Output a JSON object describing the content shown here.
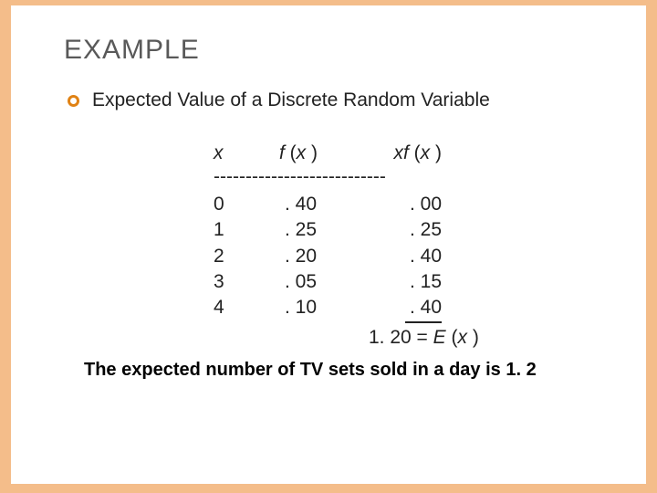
{
  "title": "EXAMPLE",
  "subtitle": "Expected Value of a Discrete Random Variable",
  "headers": {
    "x": "x",
    "fx_f": "f",
    "fx_paren": "(x )",
    "xfx_x": "x",
    "xfx_f": "f",
    "xfx_paren": "(x )"
  },
  "dashline": "---------------------------",
  "rows": [
    {
      "x": "0",
      "fx": ". 40",
      "xfx": ". 00"
    },
    {
      "x": "1",
      "fx": ". 25",
      "xfx": ". 25"
    },
    {
      "x": "2",
      "fx": ". 20",
      "xfx": ". 40"
    },
    {
      "x": "3",
      "fx": ". 05",
      "xfx": ". 15"
    },
    {
      "x": "4",
      "fx": ". 10",
      "xfx": ". 40"
    }
  ],
  "result": {
    "sum": "1. 20",
    "eq": " = ",
    "E": "E",
    "paren": "(x )"
  },
  "conclusion": "The expected number of TV sets sold in a day is 1. 2",
  "chart_data": {
    "type": "table",
    "title": "Expected Value of a Discrete Random Variable",
    "columns": [
      "x",
      "f(x)",
      "x·f(x)"
    ],
    "rows": [
      [
        0,
        0.4,
        0.0
      ],
      [
        1,
        0.25,
        0.25
      ],
      [
        2,
        0.2,
        0.4
      ],
      [
        3,
        0.05,
        0.15
      ],
      [
        4,
        0.1,
        0.4
      ]
    ],
    "expected_value": 1.2
  }
}
